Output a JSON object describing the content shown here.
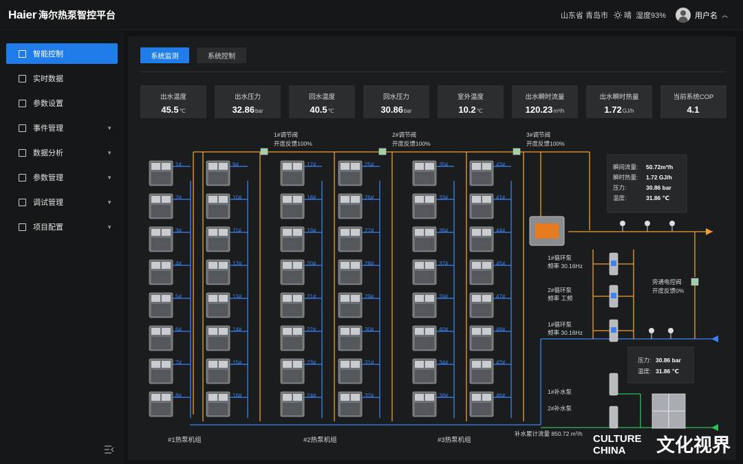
{
  "header": {
    "logo": "Haier",
    "title": "海尔热泵智控平台",
    "location": "山东省 青岛市",
    "weather": "晴",
    "humidity": "湿度93%",
    "username": "用户名"
  },
  "sidebar": {
    "items": [
      {
        "label": "智能控制",
        "active": true,
        "icon": "monitor-icon"
      },
      {
        "label": "实时数据",
        "icon": "data-screen-icon"
      },
      {
        "label": "参数设置",
        "icon": "settings-board-icon"
      },
      {
        "label": "事件管理",
        "expandable": true,
        "icon": "event-icon"
      },
      {
        "label": "数据分析",
        "expandable": true,
        "icon": "analysis-icon"
      },
      {
        "label": "参数管理",
        "expandable": true,
        "icon": "param-icon"
      },
      {
        "label": "调试管理",
        "expandable": true,
        "icon": "debug-icon"
      },
      {
        "label": "项目配置",
        "expandable": true,
        "icon": "config-icon"
      }
    ]
  },
  "tabs": [
    {
      "label": "系统监测",
      "active": true
    },
    {
      "label": "系统控制",
      "active": false
    }
  ],
  "stats": [
    {
      "label": "出水温度",
      "value": "45.5",
      "unit": "℃"
    },
    {
      "label": "出水压力",
      "value": "32.86",
      "unit": "bar"
    },
    {
      "label": "回水温度",
      "value": "40.5",
      "unit": "℃"
    },
    {
      "label": "回水压力",
      "value": "30.86",
      "unit": "bar"
    },
    {
      "label": "室外温度",
      "value": "10.2",
      "unit": "℃"
    },
    {
      "label": "出水瞬时流量",
      "value": "120.23",
      "unit": "m³/h"
    },
    {
      "label": "出水瞬时热量",
      "value": "1.72",
      "unit": "GJ/h"
    },
    {
      "label": "当前系统COP",
      "value": "4.1",
      "unit": ""
    }
  ],
  "diagram": {
    "valves": [
      {
        "name": "1#调节阀",
        "feedback": "开度反馈100%"
      },
      {
        "name": "2#调节阀",
        "feedback": "开度反馈100%"
      },
      {
        "name": "3#调节阀",
        "feedback": "开度反馈100%"
      }
    ],
    "groups": [
      {
        "label": "#1热泵机组",
        "columns": [
          [
            "1#",
            "2#",
            "3#",
            "4#",
            "5#",
            "6#",
            "7#",
            "8#"
          ],
          [
            "9#",
            "10#",
            "11#",
            "12#",
            "13#",
            "14#",
            "15#",
            "16#"
          ]
        ]
      },
      {
        "label": "#2热泵机组",
        "columns": [
          [
            "17#",
            "18#",
            "19#",
            "20#",
            "21#",
            "22#",
            "23#",
            "24#"
          ],
          [
            "25#",
            "26#",
            "27#",
            "28#",
            "29#",
            "30#",
            "31#",
            "32#"
          ]
        ]
      },
      {
        "label": "#3热泵机组",
        "columns": [
          [
            "35#",
            "33#",
            "36#",
            "37#",
            "39#",
            "40#",
            "34#",
            "38#"
          ],
          [
            "43#",
            "41#",
            "44#",
            "45#",
            "47#",
            "48#",
            "42#",
            "46#"
          ]
        ]
      }
    ],
    "supply_info": [
      {
        "label": "瞬间流量:",
        "value": "50.72m³/h"
      },
      {
        "label": "瞬时热量:",
        "value": "1.72 GJ/h"
      },
      {
        "label": "压力:",
        "value": "30.86 bar"
      },
      {
        "label": "温度:",
        "value": "31.86 ℃"
      }
    ],
    "return_info": [
      {
        "label": "压力:",
        "value": "30.86 bar"
      },
      {
        "label": "温度:",
        "value": "31.86 ℃"
      }
    ],
    "pumps": [
      {
        "name": "1#循环泵",
        "detail": "频率 30.16Hz"
      },
      {
        "name": "2#循环泵",
        "detail": "频率 工频"
      },
      {
        "name": "1#循环泵",
        "detail": "频率 30.16Hz"
      }
    ],
    "bypass": {
      "name": "旁通电控阀",
      "feedback": "开度反馈0%"
    },
    "makeup": {
      "pump1": "1#补水泵",
      "pump2": "2#补水泵",
      "total": "补水累计流量 850.72 m³/h"
    },
    "colors": {
      "hot": "#f0a032",
      "cold": "#3b82f6",
      "makeup": "#2fbf55"
    }
  },
  "watermark": {
    "line1": "CULTURE",
    "line2": "CHINA",
    "brand": "文化视界"
  }
}
